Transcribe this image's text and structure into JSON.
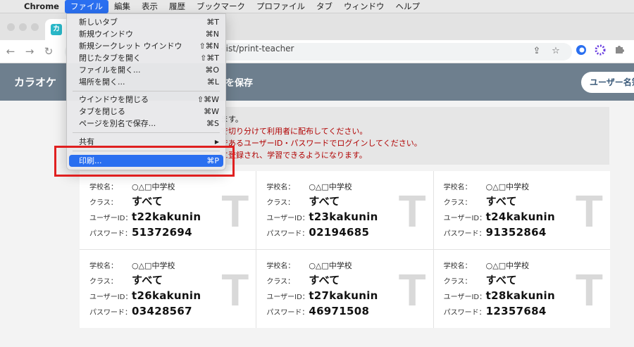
{
  "menubar": {
    "items": [
      "Chrome",
      "ファイル",
      "編集",
      "表示",
      "履歴",
      "ブックマーク",
      "プロファイル",
      "タブ",
      "ウィンドウ",
      "ヘルプ"
    ]
  },
  "tab": {
    "favicon_text": "カ"
  },
  "toolbar": {
    "url": "-list/print-teacher"
  },
  "header": {
    "title": "カラオケ",
    "title_suffix": "を保存",
    "button_label": "ユーザー名簿"
  },
  "notice": {
    "lines": [
      "ます。",
      "で切り分けて利用者に配布してください。",
      "であるユーザーID・パスワードでログインしてください。",
      "に登録され、学習できるようになります。"
    ]
  },
  "labels": {
    "school": "学校名：",
    "class": "クラス：",
    "user_id": "ユーザーID：",
    "password": "パスワード："
  },
  "cards": [
    {
      "school": "○△□中学校",
      "class": "すべて",
      "user_id": "t22kakunin",
      "password": "51372694",
      "mark": "T"
    },
    {
      "school": "○△□中学校",
      "class": "すべて",
      "user_id": "t23kakunin",
      "password": "02194685",
      "mark": "T"
    },
    {
      "school": "○△□中学校",
      "class": "すべて",
      "user_id": "t24kakunin",
      "password": "91352864",
      "mark": "T"
    },
    {
      "school": "○△□中学校",
      "class": "すべて",
      "user_id": "t26kakunin",
      "password": "03428567",
      "mark": "T"
    },
    {
      "school": "○△□中学校",
      "class": "すべて",
      "user_id": "t27kakunin",
      "password": "46971508",
      "mark": "T"
    },
    {
      "school": "○△□中学校",
      "class": "すべて",
      "user_id": "t28kakunin",
      "password": "12357684",
      "mark": "T"
    }
  ],
  "file_menu": {
    "items": [
      {
        "label": "新しいタブ",
        "shortcut": "⌘T"
      },
      {
        "label": "新規ウインドウ",
        "shortcut": "⌘N"
      },
      {
        "label": "新規シークレット ウインドウ",
        "shortcut": "⇧⌘N"
      },
      {
        "label": "閉じたタブを開く",
        "shortcut": "⇧⌘T"
      },
      {
        "label": "ファイルを開く...",
        "shortcut": "⌘O"
      },
      {
        "label": "場所を開く...",
        "shortcut": "⌘L"
      },
      {
        "label": "ウインドウを閉じる",
        "shortcut": "⇧⌘W"
      },
      {
        "label": "タブを閉じる",
        "shortcut": "⌘W"
      },
      {
        "label": "ページを別名で保存...",
        "shortcut": "⌘S"
      },
      {
        "label": "共有",
        "shortcut": "▶"
      },
      {
        "label": "印刷...",
        "shortcut": "⌘P"
      }
    ]
  }
}
